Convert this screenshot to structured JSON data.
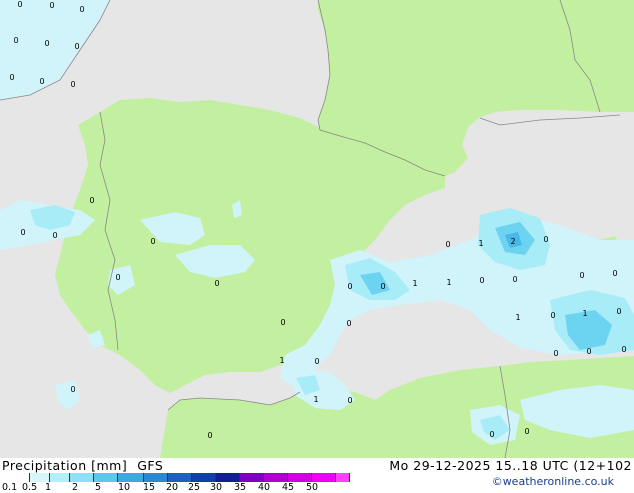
{
  "map": {
    "colors": {
      "sea": "#e6e6e6",
      "land": "#c3f0a0",
      "precip_light": "#d0f4fa",
      "precip_mid": "#a8ecf8",
      "precip_heavy": "#6cd4f0",
      "precip_core": "#48b8e8",
      "border": "#888888"
    },
    "point_labels": [
      "0",
      "0",
      "0",
      "0",
      "0",
      "0",
      "0",
      "0",
      "0",
      "0",
      "0",
      "0",
      "0",
      "0",
      "0",
      "0",
      "0",
      "1",
      "1",
      "0",
      "0",
      "0",
      "1",
      "2",
      "0",
      "0",
      "0",
      "0",
      "0",
      "1",
      "0",
      "1",
      "0",
      "1",
      "0",
      "0",
      "0",
      "0",
      "1",
      "0",
      "0",
      "0",
      "0",
      "0"
    ]
  },
  "footer": {
    "title": "Precipitation [mm]",
    "model": "GFS",
    "datetime": "Mo 29-12-2025 15..18 UTC (12+102",
    "credit": "©weatheronline.co.uk",
    "legend": {
      "ticks": [
        "0.1",
        "0.5",
        "1",
        "2",
        "5",
        "10",
        "15",
        "20",
        "25",
        "30",
        "35",
        "40",
        "45",
        "50"
      ],
      "colors": [
        "#ffffff",
        "#d8f6fa",
        "#b4eef8",
        "#8ce2f4",
        "#5cc8ec",
        "#3ca8e0",
        "#2c88d0",
        "#1c60c0",
        "#1040a8",
        "#102090",
        "#8000c0",
        "#b000d0",
        "#d000e0",
        "#f000f0",
        "#ff40ff"
      ]
    }
  }
}
